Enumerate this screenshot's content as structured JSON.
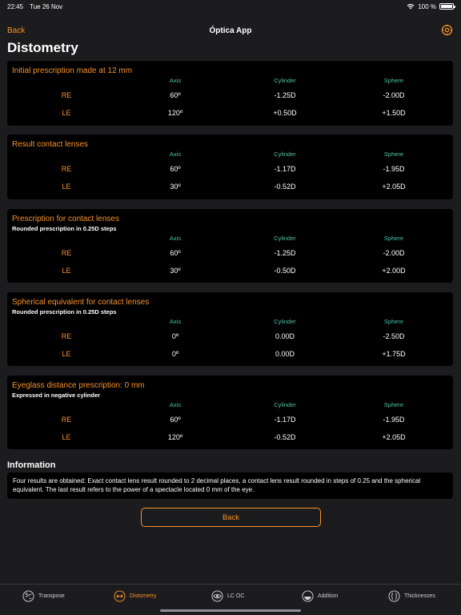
{
  "status": {
    "time": "22:45",
    "date": "Tue 26 Nov",
    "battery": "100 %"
  },
  "nav": {
    "back": "Back",
    "title": "Óptica App"
  },
  "page_title": "Distometry",
  "columns": {
    "axis": "Axis",
    "cylinder": "Cylinder",
    "sphere": "Sphere"
  },
  "cards": [
    {
      "title": "Initial prescription made at 12 mm",
      "subtitle": "",
      "rows": [
        {
          "eye": "RE",
          "axis": "60º",
          "cylinder": "-1.25D",
          "sphere": "-2.00D"
        },
        {
          "eye": "LE",
          "axis": "120º",
          "cylinder": "+0.50D",
          "sphere": "+1.50D"
        }
      ]
    },
    {
      "title": "Result contact lenses",
      "subtitle": "",
      "rows": [
        {
          "eye": "RE",
          "axis": "60º",
          "cylinder": "-1.17D",
          "sphere": "-1.95D"
        },
        {
          "eye": "LE",
          "axis": "30º",
          "cylinder": "-0.52D",
          "sphere": "+2.05D"
        }
      ]
    },
    {
      "title": "Prescription for contact lenses",
      "subtitle": "Rounded prescription in 0.25D steps",
      "rows": [
        {
          "eye": "RE",
          "axis": "60º",
          "cylinder": "-1.25D",
          "sphere": "-2.00D"
        },
        {
          "eye": "LE",
          "axis": "30º",
          "cylinder": "-0.50D",
          "sphere": "+2.00D"
        }
      ]
    },
    {
      "title": "Spherical equivalent for contact lenses",
      "subtitle": "Rounded prescription in 0.25D steps",
      "rows": [
        {
          "eye": "RE",
          "axis": "0º",
          "cylinder": "0.00D",
          "sphere": "-2.50D"
        },
        {
          "eye": "LE",
          "axis": "0º",
          "cylinder": "0.00D",
          "sphere": "+1.75D"
        }
      ]
    },
    {
      "title": "Eyeglass distance prescription: 0 mm",
      "subtitle": "Expressed in negative cylinder",
      "rows": [
        {
          "eye": "RE",
          "axis": "60º",
          "cylinder": "-1.17D",
          "sphere": "-1.95D"
        },
        {
          "eye": "LE",
          "axis": "120º",
          "cylinder": "-0.52D",
          "sphere": "+2.05D"
        }
      ]
    }
  ],
  "information": {
    "title": "Information",
    "text": "Four results are obtained: Exact contact lens result rounded to 2 decimal places, a contact lens result rounded in steps of 0.25 and the spherical equivalent. The last result refers to the power of a spectacle located 0 mm of the eye."
  },
  "back_button": "Back",
  "tabs": [
    {
      "label": "Transpose",
      "icon": "transpose-icon"
    },
    {
      "label": "Distometry",
      "icon": "distometry-icon",
      "active": true
    },
    {
      "label": "LC OC",
      "icon": "eye-icon"
    },
    {
      "label": "Addition",
      "icon": "addition-icon"
    },
    {
      "label": "Thicknesses",
      "icon": "thickness-icon"
    }
  ],
  "colors": {
    "accent": "#f5922b",
    "column_header": "#4ec2a6",
    "card": "#000000",
    "background": "#1c1c1e"
  }
}
